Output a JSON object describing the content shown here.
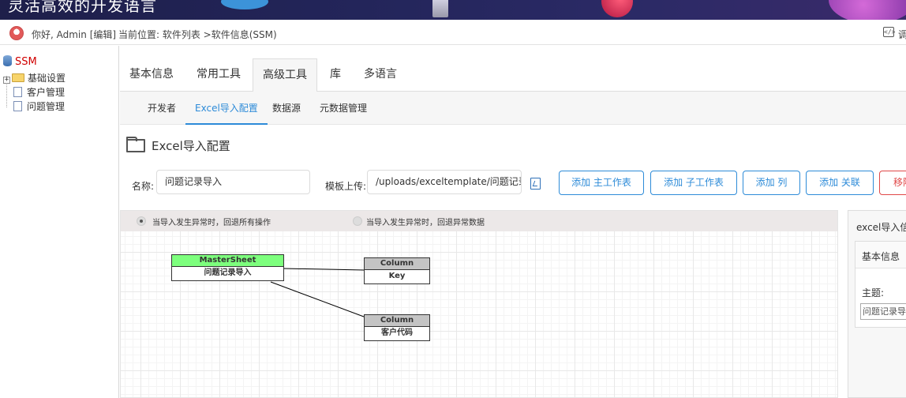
{
  "banner": {
    "title": "灵活高效的开发语言"
  },
  "userbar": {
    "greeting": "你好, Admin [编辑]",
    "breadcrumb": "当前位置: 软件列表 >软件信息(SSM)",
    "code_label": "调"
  },
  "sidebar": {
    "root": "SSM",
    "items": [
      {
        "label": "基础设置",
        "icon": "folder-icon",
        "expandable": true
      },
      {
        "label": "客户管理",
        "icon": "page-icon",
        "expandable": false
      },
      {
        "label": "问题管理",
        "icon": "page-icon",
        "expandable": false
      }
    ]
  },
  "tabs": [
    "基本信息",
    "常用工具",
    "高级工具",
    "库",
    "多语言"
  ],
  "active_tab": "高级工具",
  "subtabs": [
    "开发者",
    "Excel导入配置",
    "数据源",
    "元数据管理"
  ],
  "active_subtab": "Excel导入配置",
  "section": {
    "title": "Excel导入配置"
  },
  "form": {
    "name_label": "名称:",
    "name_value": "问题记录导入",
    "template_label": "模板上传:",
    "template_value": "/uploads/exceltemplate/问题记录导入.xlsx"
  },
  "buttons": {
    "add_main": "添加 主工作表",
    "add_sub": "添加 子工作表",
    "add_column": "添加 列",
    "add_relation": "添加 关联",
    "remove": "移除"
  },
  "options": {
    "rollback_all": "当导入发生异常时，回退所有操作",
    "rollback_errors": "当导入发生异常时，回退异常数据",
    "selected": "rollback_all"
  },
  "diagram": {
    "master": {
      "type": "MasterSheet",
      "name": "问题记录导入"
    },
    "columns": [
      {
        "type": "Column",
        "name": "Key"
      },
      {
        "type": "Column",
        "name": "客户代码"
      }
    ]
  },
  "panel": {
    "title": "excel导入信息",
    "section": "基本信息",
    "subject_label": "主题:",
    "subject_value": "问题记录导入"
  },
  "colors": {
    "accent": "#2d8bd8",
    "danger": "#e04848",
    "master_head": "#7dff7d",
    "column_head": "#c4c4c4"
  }
}
